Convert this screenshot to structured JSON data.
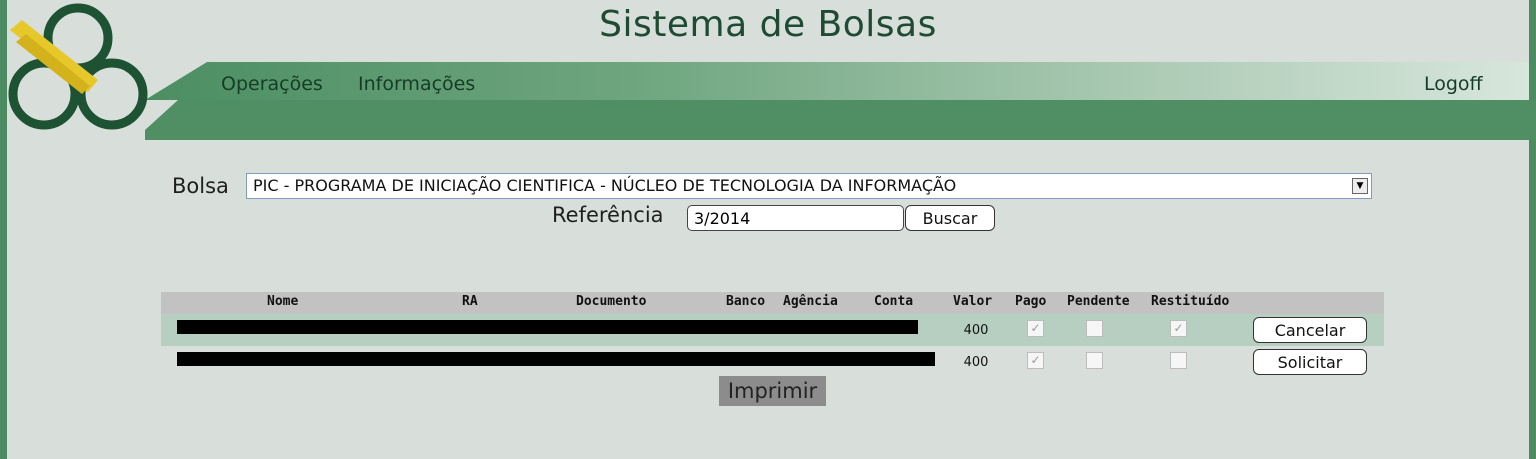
{
  "header": {
    "title": "Sistema de Bolsas",
    "nav": [
      "Operações",
      "Informações"
    ],
    "logoff": "Logoff"
  },
  "form": {
    "bolsa_label": "Bolsa",
    "bolsa_value": "PIC - PROGRAMA DE INICIAÇÃO CIENTIFICA - NÚCLEO DE TECNOLOGIA DA INFORMAÇÃO",
    "referencia_label": "Referência",
    "referencia_value": "3/2014",
    "buscar_label": "Buscar"
  },
  "table": {
    "columns": [
      "Nome",
      "RA",
      "Documento",
      "Banco",
      "Agência",
      "Conta",
      "Valor",
      "Pago",
      "Pendente",
      "Restituído"
    ],
    "rows": [
      {
        "valor": "400",
        "pago": true,
        "pendente": false,
        "restituido": true,
        "action": "Cancelar"
      },
      {
        "valor": "400",
        "pago": true,
        "pendente": false,
        "restituido": false,
        "action": "Solicitar"
      }
    ]
  },
  "imprimir_label": "Imprimir",
  "colors": {
    "header_green": "#4f8f63",
    "background": "#d8dfdb",
    "title_color": "#1f4a33",
    "highlight_row": "#b7cfc1"
  },
  "icons": [
    "logo-icon",
    "dropdown-arrow-icon",
    "checkmark-icon"
  ]
}
